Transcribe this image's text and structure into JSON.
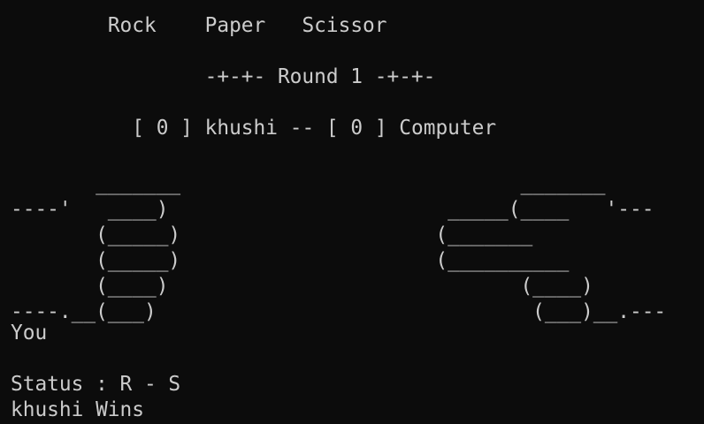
{
  "title": {
    "rock": "Rock",
    "paper": "Paper",
    "scissor": "Scissor"
  },
  "round_text": "-+-+- Round 1 -+-+-",
  "score": {
    "player_score": "0",
    "player_name": "khushi",
    "separator": "--",
    "computer_score": "0",
    "computer_name": "Computer"
  },
  "hands_art": "       _______                            _______\n----'   ____)                       _____(____   '---\n       (_____)                     (_______\n       (_____)                     (__________\n       (____)                             (____)\n----.__(___)                               (___)__.---",
  "you_label": "You",
  "status_line": "Status : R - S",
  "result_line": "khushi Wins"
}
